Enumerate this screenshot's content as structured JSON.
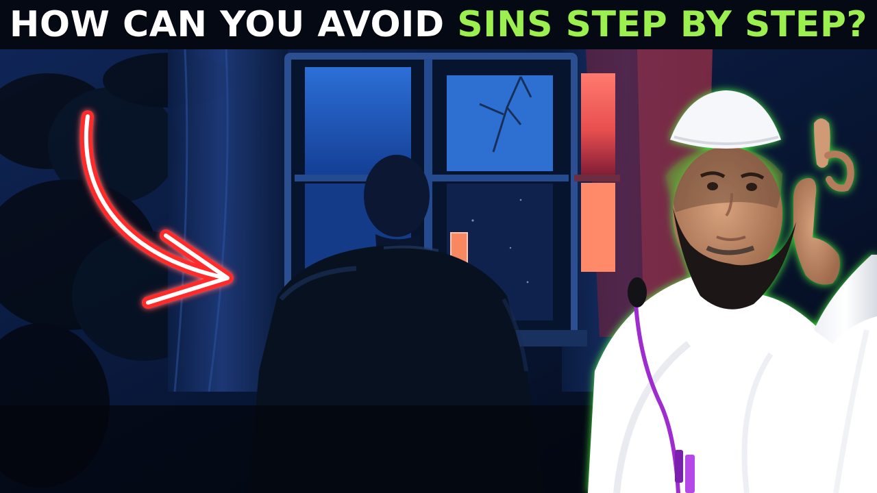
{
  "thumbnail": {
    "title_part1": "HOW CAN YOU AVOID",
    "title_part2": "SINS STEP BY STEP?",
    "colors": {
      "title_white": "#ffffff",
      "title_green": "#9bef4f",
      "arrow_red": "#ff2a2a",
      "speaker_glow": "#49ff3c"
    },
    "elements": {
      "arrow": "curved-arrow-icon",
      "speaker": "speaker-cutout",
      "scene": "man-at-window-painting"
    }
  }
}
